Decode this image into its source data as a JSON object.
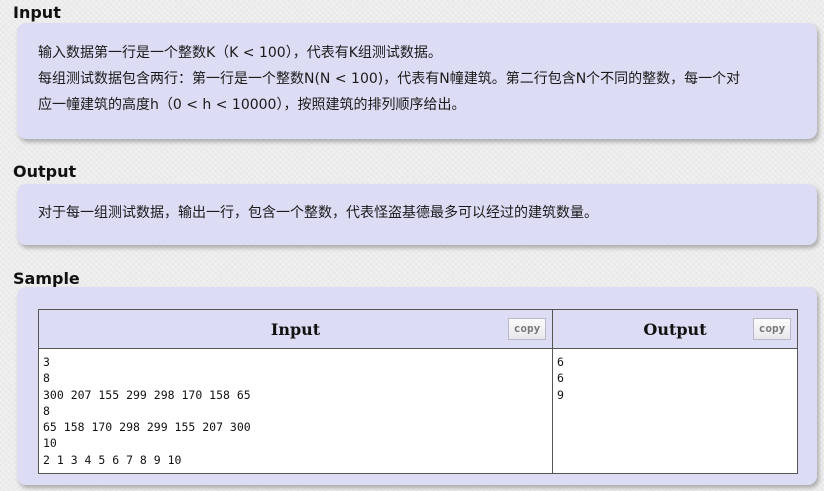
{
  "input_section": {
    "title": "Input",
    "lines": [
      "输入数据第一行是一个整数K（K < 100），代表有K组测试数据。",
      "每组测试数据包含两行：第一行是一个整数N(N < 100)，代表有N幢建筑。第二行包含N个不同的整数，每一个对",
      "应一幢建筑的高度h（0 < h < 10000），按照建筑的排列顺序给出。"
    ]
  },
  "output_section": {
    "title": "Output",
    "lines": [
      "对于每一组测试数据，输出一行，包含一个整数，代表怪盗基德最多可以经过的建筑数量。"
    ]
  },
  "sample_section": {
    "title": "Sample",
    "input_header": "Input",
    "output_header": "Output",
    "copy_label": "copy",
    "input_text": "3\n8\n300 207 155 299 298 170 158 65\n8\n65 158 170 298 299 155 207 300\n10\n2 1 3 4 5 6 7 8 9 10",
    "output_text": "6\n6\n9"
  },
  "colors": {
    "panel_background": "#dcdcf4",
    "page_background": "#ececec"
  }
}
